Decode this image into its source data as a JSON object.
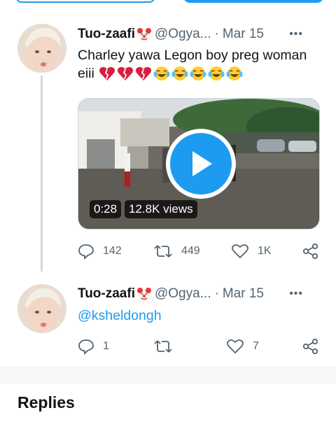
{
  "tweet1": {
    "name": "Tuo-zaafi",
    "handle": "@Ogya...",
    "separator": "·",
    "date": "Mar 15",
    "more": "•••",
    "text": "Charley yawa Legon boy preg woman",
    "text_line2": "eiii",
    "emojis": [
      "broken-heart",
      "broken-heart",
      "broken-heart",
      "joy",
      "joy",
      "joy",
      "joy",
      "joy"
    ],
    "video": {
      "duration": "0:28",
      "views": "12.8K views"
    },
    "actions": {
      "replies": "142",
      "retweets": "449",
      "likes": "1K"
    }
  },
  "tweet2": {
    "name": "Tuo-zaafi",
    "handle": "@Ogya...",
    "separator": "·",
    "date": "Mar 15",
    "more": "•••",
    "text": "@ksheldongh",
    "actions": {
      "replies": "1",
      "retweets": "",
      "likes": "7"
    }
  },
  "replies_heading": "Replies",
  "colors": {
    "accent": "#1d9bf0",
    "muted": "#536471",
    "text": "#0f1419",
    "heart_emoji": "#d81e3f",
    "joy_emoji": "#ffcc33"
  }
}
